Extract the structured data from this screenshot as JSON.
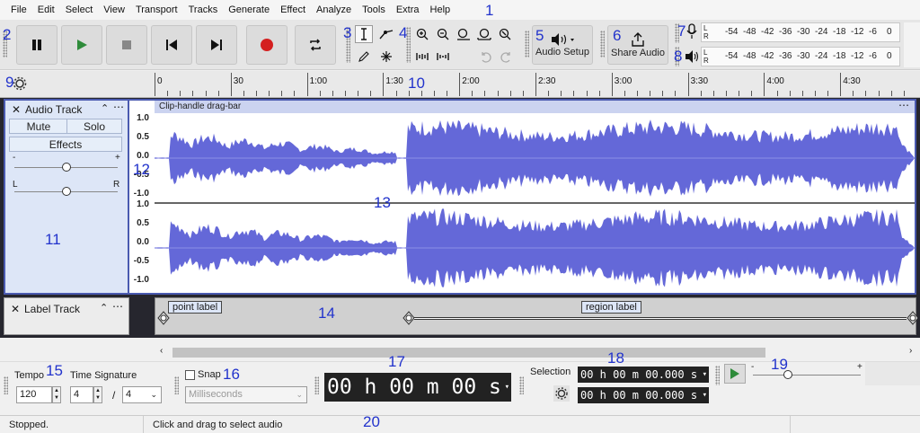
{
  "menu": [
    "File",
    "Edit",
    "Select",
    "View",
    "Transport",
    "Tracks",
    "Generate",
    "Effect",
    "Analyze",
    "Tools",
    "Extra",
    "Help"
  ],
  "callouts": [
    "1",
    "2",
    "3",
    "4",
    "5",
    "6",
    "7",
    "8",
    "9",
    "10",
    "11",
    "12",
    "13",
    "14",
    "15",
    "16",
    "17",
    "18",
    "19",
    "20"
  ],
  "toolbar": {
    "audio_setup_label": "Audio Setup",
    "share_audio_label": "Share Audio",
    "meter_ticks": [
      "-54",
      "-48",
      "-42",
      "-36",
      "-30",
      "-24",
      "-18",
      "-12",
      "-6",
      "0"
    ],
    "meter_L": "L",
    "meter_R": "R",
    "icons": {
      "pause": "pause-icon",
      "play": "play-icon",
      "stop": "stop-icon",
      "skip_start": "skip-to-start-icon",
      "skip_end": "skip-to-end-icon",
      "record": "record-icon",
      "loop": "loop-icon"
    },
    "colors": {
      "play": "#2e8b3a",
      "record": "#d42020"
    }
  },
  "timeline": {
    "labels": [
      "0",
      "30",
      "1:00",
      "1:30",
      "2:00",
      "2:30",
      "3:00",
      "3:30",
      "4:00",
      "4:30"
    ]
  },
  "audio_track": {
    "name": "Audio Track",
    "mute": "Mute",
    "solo": "Solo",
    "effects": "Effects",
    "gain_minus": "-",
    "gain_plus": "+",
    "pan_L": "L",
    "pan_R": "R",
    "clip_name": "Clip-handle drag-bar",
    "scale": [
      "1.0",
      "0.5",
      "0.0",
      "-0.5",
      "-1.0"
    ],
    "waveform_color": "#6468d8"
  },
  "label_track": {
    "name": "Label Track",
    "labels": [
      "point label",
      "region label"
    ]
  },
  "bottom": {
    "tempo_label": "Tempo",
    "tempo_value": "120",
    "time_sig_label": "Time Signature",
    "time_sig_num": "4",
    "time_sig_den": "4",
    "snap_label": "Snap",
    "snap_unit": "Milliseconds",
    "time_display": "00 h 00 m 00 s",
    "selection_label": "Selection",
    "selection_start": "00 h 00 m 00.000 s",
    "selection_end": "00 h 00 m 00.000 s",
    "speed_minus": "-",
    "speed_plus": "+"
  },
  "status": {
    "state": "Stopped.",
    "hint": "Click and drag to select audio"
  }
}
